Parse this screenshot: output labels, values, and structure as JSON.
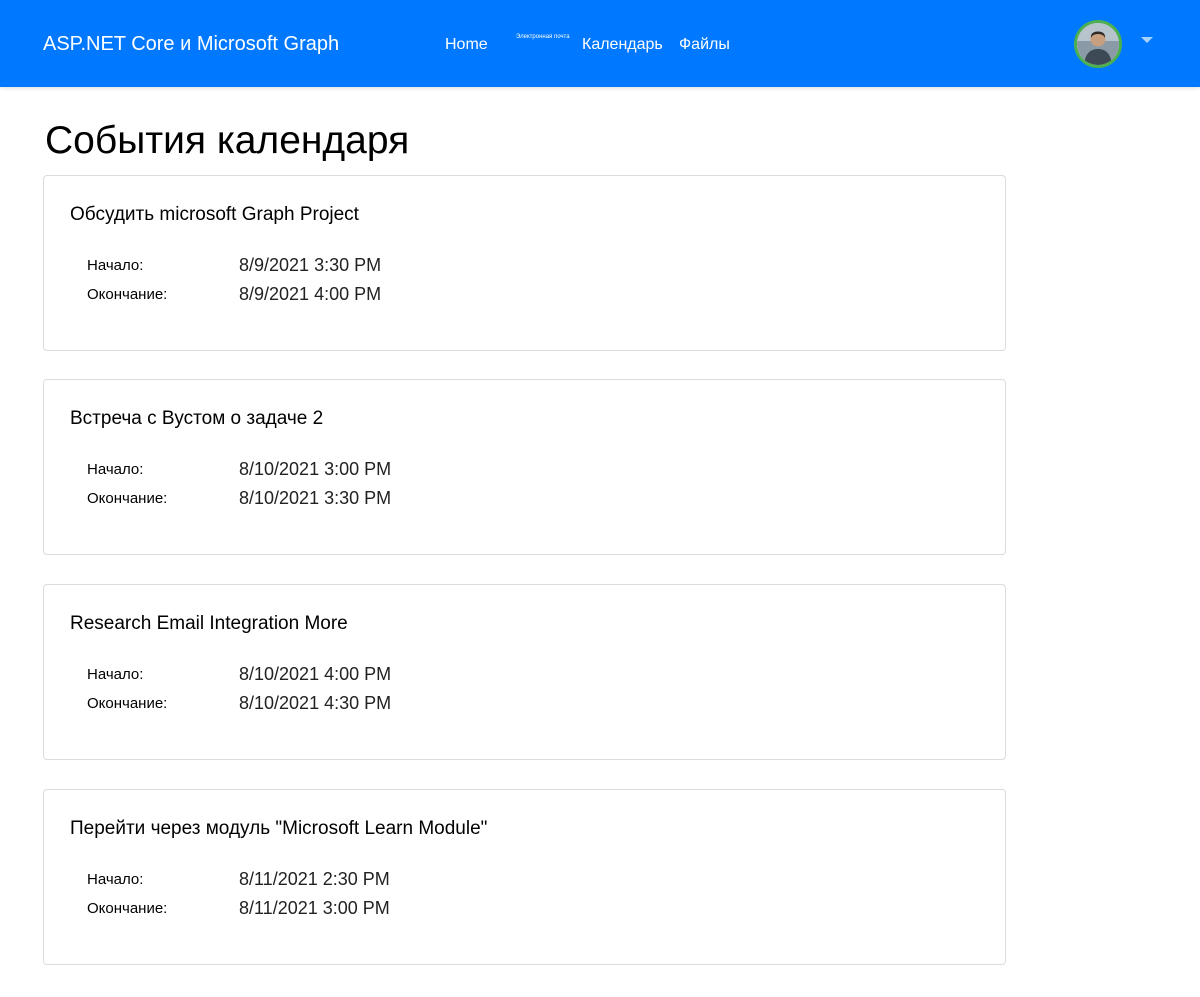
{
  "navbar": {
    "brand": "ASP.NET Core и Microsoft Graph",
    "links": {
      "home": "Home",
      "mail": "Электронная почта",
      "calendar": "Календарь",
      "files": "Файлы"
    },
    "accent_color": "#0078ff",
    "avatar_ring_color": "#4caf50",
    "avatar_icon": "user-avatar-icon",
    "menu_icon": "chevron-down-icon"
  },
  "page": {
    "title": "События календаря"
  },
  "labels": {
    "start": "Начало:",
    "end": "Окончание:"
  },
  "events": [
    {
      "subject": "Обсудить microsoft Graph Project",
      "start": "8/9/2021 3:30 PM",
      "end": "8/9/2021 4:00 PM"
    },
    {
      "subject": "Встреча с Вустом о задаче 2",
      "start": "8/10/2021 3:00 PM",
      "end": "8/10/2021 3:30 PM"
    },
    {
      "subject": "Research Email Integration More",
      "start": "8/10/2021 4:00 PM",
      "end": "8/10/2021 4:30 PM"
    },
    {
      "subject": "Перейти через модуль \"Microsoft Learn Module\"",
      "start": "8/11/2021 2:30 PM",
      "end": "8/11/2021 3:00 PM"
    }
  ]
}
